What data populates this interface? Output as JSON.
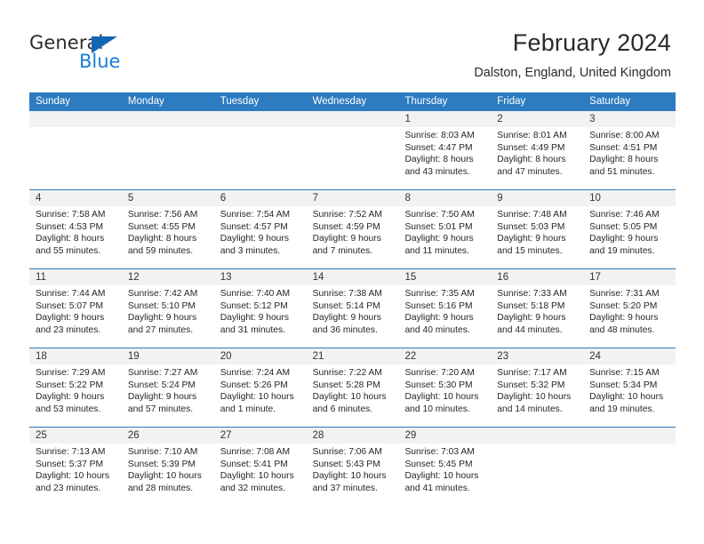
{
  "brand": {
    "name_top": "General",
    "name_bottom": "Blue",
    "accent_color": "#1a7fd4",
    "triangle_color": "#1266b3"
  },
  "header": {
    "title": "February 2024",
    "subtitle": "Dalston, England, United Kingdom"
  },
  "calendar": {
    "header_bg": "#2d7bc0",
    "header_text_color": "#ffffff",
    "day_band_bg": "#f2f2f2",
    "weekdays": [
      "Sunday",
      "Monday",
      "Tuesday",
      "Wednesday",
      "Thursday",
      "Friday",
      "Saturday"
    ],
    "weeks": [
      [
        {
          "day": "",
          "lines": []
        },
        {
          "day": "",
          "lines": []
        },
        {
          "day": "",
          "lines": []
        },
        {
          "day": "",
          "lines": []
        },
        {
          "day": "1",
          "lines": [
            "Sunrise: 8:03 AM",
            "Sunset: 4:47 PM",
            "Daylight: 8 hours",
            "and 43 minutes."
          ]
        },
        {
          "day": "2",
          "lines": [
            "Sunrise: 8:01 AM",
            "Sunset: 4:49 PM",
            "Daylight: 8 hours",
            "and 47 minutes."
          ]
        },
        {
          "day": "3",
          "lines": [
            "Sunrise: 8:00 AM",
            "Sunset: 4:51 PM",
            "Daylight: 8 hours",
            "and 51 minutes."
          ]
        }
      ],
      [
        {
          "day": "4",
          "lines": [
            "Sunrise: 7:58 AM",
            "Sunset: 4:53 PM",
            "Daylight: 8 hours",
            "and 55 minutes."
          ]
        },
        {
          "day": "5",
          "lines": [
            "Sunrise: 7:56 AM",
            "Sunset: 4:55 PM",
            "Daylight: 8 hours",
            "and 59 minutes."
          ]
        },
        {
          "day": "6",
          "lines": [
            "Sunrise: 7:54 AM",
            "Sunset: 4:57 PM",
            "Daylight: 9 hours",
            "and 3 minutes."
          ]
        },
        {
          "day": "7",
          "lines": [
            "Sunrise: 7:52 AM",
            "Sunset: 4:59 PM",
            "Daylight: 9 hours",
            "and 7 minutes."
          ]
        },
        {
          "day": "8",
          "lines": [
            "Sunrise: 7:50 AM",
            "Sunset: 5:01 PM",
            "Daylight: 9 hours",
            "and 11 minutes."
          ]
        },
        {
          "day": "9",
          "lines": [
            "Sunrise: 7:48 AM",
            "Sunset: 5:03 PM",
            "Daylight: 9 hours",
            "and 15 minutes."
          ]
        },
        {
          "day": "10",
          "lines": [
            "Sunrise: 7:46 AM",
            "Sunset: 5:05 PM",
            "Daylight: 9 hours",
            "and 19 minutes."
          ]
        }
      ],
      [
        {
          "day": "11",
          "lines": [
            "Sunrise: 7:44 AM",
            "Sunset: 5:07 PM",
            "Daylight: 9 hours",
            "and 23 minutes."
          ]
        },
        {
          "day": "12",
          "lines": [
            "Sunrise: 7:42 AM",
            "Sunset: 5:10 PM",
            "Daylight: 9 hours",
            "and 27 minutes."
          ]
        },
        {
          "day": "13",
          "lines": [
            "Sunrise: 7:40 AM",
            "Sunset: 5:12 PM",
            "Daylight: 9 hours",
            "and 31 minutes."
          ]
        },
        {
          "day": "14",
          "lines": [
            "Sunrise: 7:38 AM",
            "Sunset: 5:14 PM",
            "Daylight: 9 hours",
            "and 36 minutes."
          ]
        },
        {
          "day": "15",
          "lines": [
            "Sunrise: 7:35 AM",
            "Sunset: 5:16 PM",
            "Daylight: 9 hours",
            "and 40 minutes."
          ]
        },
        {
          "day": "16",
          "lines": [
            "Sunrise: 7:33 AM",
            "Sunset: 5:18 PM",
            "Daylight: 9 hours",
            "and 44 minutes."
          ]
        },
        {
          "day": "17",
          "lines": [
            "Sunrise: 7:31 AM",
            "Sunset: 5:20 PM",
            "Daylight: 9 hours",
            "and 48 minutes."
          ]
        }
      ],
      [
        {
          "day": "18",
          "lines": [
            "Sunrise: 7:29 AM",
            "Sunset: 5:22 PM",
            "Daylight: 9 hours",
            "and 53 minutes."
          ]
        },
        {
          "day": "19",
          "lines": [
            "Sunrise: 7:27 AM",
            "Sunset: 5:24 PM",
            "Daylight: 9 hours",
            "and 57 minutes."
          ]
        },
        {
          "day": "20",
          "lines": [
            "Sunrise: 7:24 AM",
            "Sunset: 5:26 PM",
            "Daylight: 10 hours",
            "and 1 minute."
          ]
        },
        {
          "day": "21",
          "lines": [
            "Sunrise: 7:22 AM",
            "Sunset: 5:28 PM",
            "Daylight: 10 hours",
            "and 6 minutes."
          ]
        },
        {
          "day": "22",
          "lines": [
            "Sunrise: 7:20 AM",
            "Sunset: 5:30 PM",
            "Daylight: 10 hours",
            "and 10 minutes."
          ]
        },
        {
          "day": "23",
          "lines": [
            "Sunrise: 7:17 AM",
            "Sunset: 5:32 PM",
            "Daylight: 10 hours",
            "and 14 minutes."
          ]
        },
        {
          "day": "24",
          "lines": [
            "Sunrise: 7:15 AM",
            "Sunset: 5:34 PM",
            "Daylight: 10 hours",
            "and 19 minutes."
          ]
        }
      ],
      [
        {
          "day": "25",
          "lines": [
            "Sunrise: 7:13 AM",
            "Sunset: 5:37 PM",
            "Daylight: 10 hours",
            "and 23 minutes."
          ]
        },
        {
          "day": "26",
          "lines": [
            "Sunrise: 7:10 AM",
            "Sunset: 5:39 PM",
            "Daylight: 10 hours",
            "and 28 minutes."
          ]
        },
        {
          "day": "27",
          "lines": [
            "Sunrise: 7:08 AM",
            "Sunset: 5:41 PM",
            "Daylight: 10 hours",
            "and 32 minutes."
          ]
        },
        {
          "day": "28",
          "lines": [
            "Sunrise: 7:06 AM",
            "Sunset: 5:43 PM",
            "Daylight: 10 hours",
            "and 37 minutes."
          ]
        },
        {
          "day": "29",
          "lines": [
            "Sunrise: 7:03 AM",
            "Sunset: 5:45 PM",
            "Daylight: 10 hours",
            "and 41 minutes."
          ]
        },
        {
          "day": "",
          "lines": []
        },
        {
          "day": "",
          "lines": []
        }
      ]
    ]
  }
}
